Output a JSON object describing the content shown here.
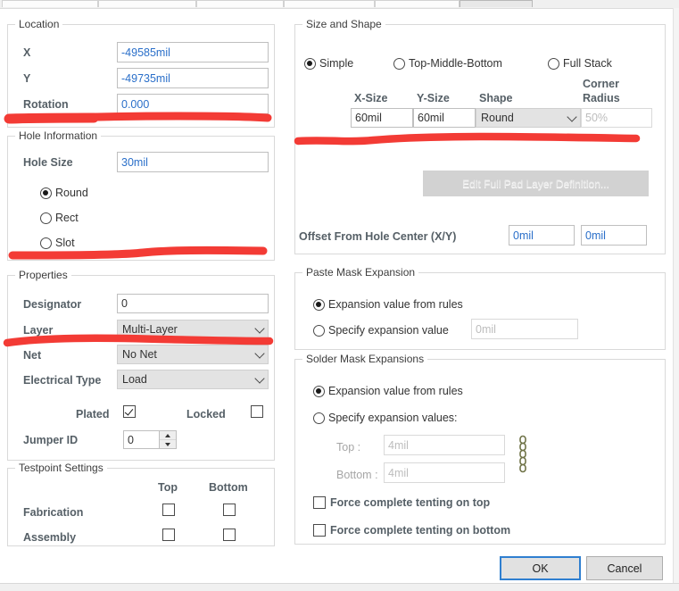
{
  "dialog": {
    "background": "#ffffff",
    "accent": "#2f7fd0",
    "value_color": "#2a6fc9",
    "marker_color": "#f33b35"
  },
  "tabstrip": {
    "tabs": [
      {
        "label": "",
        "selected": false
      },
      {
        "label": "",
        "selected": false
      },
      {
        "label": "",
        "selected": false
      },
      {
        "label": "",
        "selected": false
      },
      {
        "label": "",
        "selected": false
      },
      {
        "label": "",
        "selected": true
      }
    ]
  },
  "location": {
    "title": "Location",
    "x_label": "X",
    "x_value": "-49585mil",
    "y_label": "Y",
    "y_value": "-49735mil",
    "rotation_label": "Rotation",
    "rotation_value": "0.000"
  },
  "hole_information": {
    "title": "Hole Information",
    "hole_size_label": "Hole Size",
    "hole_size_value": "30mil",
    "shapes": [
      {
        "label": "Round",
        "selected": true
      },
      {
        "label": "Rect",
        "selected": false
      },
      {
        "label": "Slot",
        "selected": false
      }
    ]
  },
  "properties": {
    "title": "Properties",
    "designator_label": "Designator",
    "designator_value": "0",
    "layer_label": "Layer",
    "layer_value": "Multi-Layer",
    "net_label": "Net",
    "net_value": "No Net",
    "electrical_type_label": "Electrical Type",
    "electrical_type_value": "Load",
    "plated_label": "Plated",
    "plated_checked": true,
    "locked_label": "Locked",
    "locked_checked": false,
    "jumper_id_label": "Jumper ID",
    "jumper_id_value": "0"
  },
  "testpoint_settings": {
    "title": "Testpoint Settings",
    "col_top": "Top",
    "col_bottom": "Bottom",
    "rows": [
      {
        "label": "Fabrication",
        "top": false,
        "bottom": false
      },
      {
        "label": "Assembly",
        "top": false,
        "bottom": false
      }
    ]
  },
  "size_and_shape": {
    "title": "Size and Shape",
    "modes": [
      {
        "label": "Simple",
        "selected": true
      },
      {
        "label": "Top-Middle-Bottom",
        "selected": false
      },
      {
        "label": "Full Stack",
        "selected": false
      }
    ],
    "col_xsize": "X-Size",
    "col_ysize": "Y-Size",
    "col_shape": "Shape",
    "col_corner_radius_1": "Corner",
    "col_corner_radius_2": "Radius",
    "xsize_value": "60mil",
    "ysize_value": "60mil",
    "shape_value": "Round",
    "corner_radius_value": "50%",
    "edit_full_pad_button": "Edit Full Pad Layer Definition...",
    "offset_label": "Offset From Hole Center (X/Y)",
    "offset_x_value": "0mil",
    "offset_y_value": "0mil"
  },
  "paste_mask_expansion": {
    "title": "Paste Mask Expansion",
    "from_rules_label": "Expansion value from rules",
    "from_rules_selected": true,
    "specify_label": "Specify expansion value",
    "specify_selected": false,
    "specify_value": "0mil"
  },
  "solder_mask_expansions": {
    "title": "Solder Mask Expansions",
    "from_rules_label": "Expansion value from rules",
    "from_rules_selected": true,
    "specify_label": "Specify expansion values:",
    "specify_selected": false,
    "top_label": "Top :",
    "top_value": "4mil",
    "bottom_label": "Bottom :",
    "bottom_value": "4mil",
    "link_icon": "chain-link-icon",
    "force_top_label": "Force complete tenting on top",
    "force_top_checked": false,
    "force_bottom_label": "Force complete tenting on bottom",
    "force_bottom_checked": false
  },
  "footer": {
    "ok_label": "OK",
    "cancel_label": "Cancel"
  }
}
